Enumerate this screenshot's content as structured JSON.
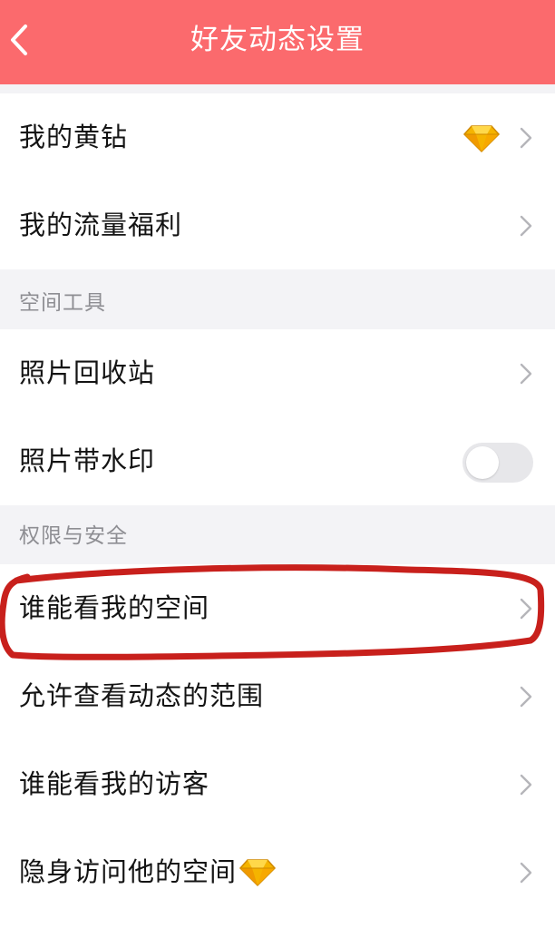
{
  "header": {
    "title": "好友动态设置",
    "background": "#fb6a6d",
    "back_icon": "chevron-left-icon"
  },
  "group_top": [
    {
      "label": "我的黄钻",
      "icon": "yellow-diamond-icon"
    },
    {
      "label": "我的流量福利"
    }
  ],
  "section_tools": {
    "title": "空间工具",
    "items": [
      {
        "label": "照片回收站"
      },
      {
        "label": "照片带水印",
        "toggle": false
      }
    ]
  },
  "section_privacy": {
    "title": "权限与安全",
    "items": [
      {
        "label": "谁能看我的空间",
        "highlighted": true
      },
      {
        "label": "允许查看动态的范围"
      },
      {
        "label": "谁能看我的访客"
      },
      {
        "label": "隐身访问他的空间",
        "icon": "yellow-diamond-icon"
      }
    ]
  },
  "colors": {
    "accent": "#fb6a6d",
    "annotation_stroke": "#c8201c",
    "diamond": "#f5b400"
  }
}
